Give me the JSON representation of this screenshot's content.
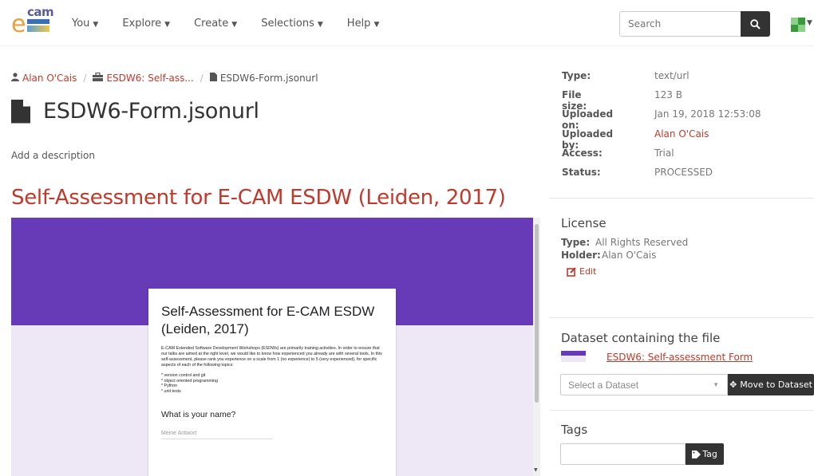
{
  "brand": {
    "logo_e": "e",
    "logo_cam": "cam"
  },
  "nav": {
    "items": [
      {
        "label": "You"
      },
      {
        "label": "Explore"
      },
      {
        "label": "Create"
      },
      {
        "label": "Selections"
      },
      {
        "label": "Help"
      }
    ],
    "search_placeholder": "Search"
  },
  "breadcrumb": {
    "user": "Alan O'Cais",
    "dataset": "ESDW6: Self-ass...",
    "file": "ESDW6-Form.jsonurl",
    "separator": "/"
  },
  "file": {
    "title": "ESDW6-Form.jsonurl",
    "add_description": "Add a description",
    "preview_title": "Self-Assessment for E-CAM ESDW (Leiden, 2017)"
  },
  "form_preview": {
    "title": "Self-Assessment for E-CAM ESDW (Leiden, 2017)",
    "description": "E-CAM Extended Software Development Workshops (ESDWs) are primarily training activities. In order to ensure that our talks are aimed at the right level, we would like to know how experienced you already are with several tools. In this self-assessment, please rank you experience on a scale from 1 (no experience) to 5 (very experienced), for specific aspects of each of the following topics:",
    "topics": [
      "* version control and git",
      "* object oriented programming",
      "* Python",
      "* unit tests"
    ],
    "question": "What is your name?",
    "answer_placeholder": "Meine Antwort"
  },
  "metadata": [
    {
      "key": "Type:",
      "value": "text/url",
      "link": false
    },
    {
      "key": "File size:",
      "value": "123 B",
      "link": false
    },
    {
      "key": "Uploaded on:",
      "value": "Jan 19, 2018 12:53:08",
      "link": false
    },
    {
      "key": "Uploaded by:",
      "value": "Alan O'Cais",
      "link": true
    },
    {
      "key": "Access:",
      "value": "Trial",
      "link": false
    },
    {
      "key": "Status:",
      "value": "PROCESSED",
      "link": false
    }
  ],
  "license": {
    "heading": "License",
    "type_label": "Type:",
    "type_value": "All Rights Reserved",
    "holder_label": "Holder:",
    "holder_value": "Alan O'Cais",
    "edit_label": "Edit"
  },
  "dataset": {
    "heading": "Dataset containing the file",
    "name": "ESDW6: Self-assessment Form",
    "select_placeholder": "Select a Dataset",
    "move_label": "Move to Dataset"
  },
  "tags": {
    "heading": "Tags",
    "button_label": "Tag"
  },
  "colors": {
    "accent": "#c0392b",
    "form_purple": "#673ab7",
    "button_dark": "#333333"
  },
  "icons": {
    "user": "user-icon",
    "dataset": "briefcase-icon",
    "file": "file-icon",
    "search": "search-icon",
    "edit": "edit-icon",
    "move": "move-icon",
    "tag": "tag-icon"
  }
}
